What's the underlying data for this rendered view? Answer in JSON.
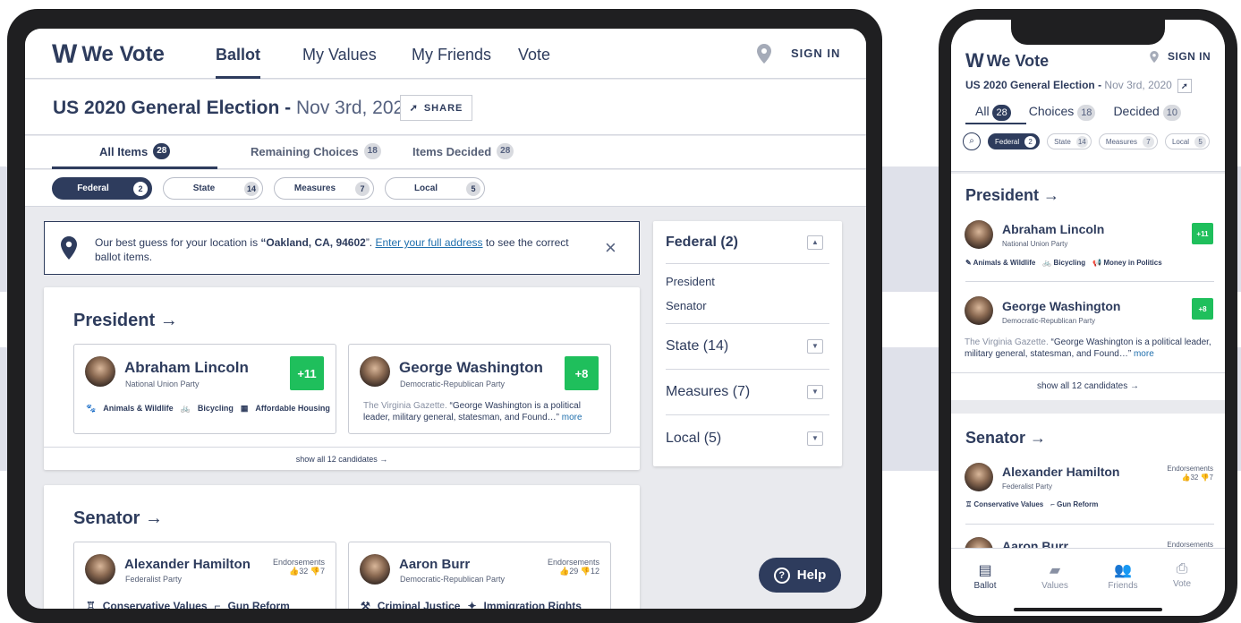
{
  "brand": {
    "name": "We Vote",
    "mark": "W"
  },
  "nav": {
    "ballot": "Ballot",
    "values": "My Values",
    "friends": "My Friends",
    "vote": "Vote",
    "signin": "SIGN IN"
  },
  "election": {
    "title": "US 2020 General Election",
    "dash": " - ",
    "date": "Nov 3rd, 2020",
    "share": "SHARE"
  },
  "tabs": [
    {
      "label": "All Items",
      "count": "28"
    },
    {
      "label": "Remaining Choices",
      "count": "18"
    },
    {
      "label": "Items Decided",
      "count": "28"
    }
  ],
  "filters": [
    {
      "label": "Federal",
      "count": "2"
    },
    {
      "label": "State",
      "count": "14"
    },
    {
      "label": "Measures",
      "count": "7"
    },
    {
      "label": "Local",
      "count": "5"
    }
  ],
  "location": {
    "prefix": "Our best guess for your location is ",
    "place": "“Oakland, CA, 94602",
    "mid": "”. ",
    "link": "Enter your full address",
    "suffix": " to see the correct ballot items.",
    "close": "×"
  },
  "president": {
    "title": "President →",
    "lincoln": {
      "name": "Abraham Lincoln",
      "party": "National Union Party",
      "score": "+11",
      "tags": [
        "Animals & Wildlife",
        "Bicycling",
        "Affordable Housing"
      ]
    },
    "washington": {
      "name": "George Washington",
      "party": "Democratic-Republican Party",
      "score": "+8",
      "source": "The Virginia Gazette.",
      "quote": " “George Washington is a political leader, military general, statesman, and Found…”",
      "more": " more"
    },
    "showall": "show all 12 candidates →"
  },
  "senator": {
    "title": "Senator →",
    "hamilton": {
      "name": "Alexander Hamilton",
      "party": "Federalist Party",
      "endorse_label": "Endorsements",
      "up": "32",
      "down": "7",
      "tags": [
        "Conservative Values",
        "Gun Reform"
      ]
    },
    "burr": {
      "name": "Aaron Burr",
      "party": "Democratic-Republican Party",
      "endorse_label": "Endorsements",
      "up": "29",
      "down": "12",
      "tags": [
        "Criminal Justice",
        "Immigration Rights"
      ]
    }
  },
  "sidebar": {
    "federal": "Federal (2)",
    "items": [
      "President",
      "Senator"
    ],
    "state": "State (14)",
    "measures": "Measures (7)",
    "local": "Local (5)"
  },
  "help": "Help",
  "phone": {
    "election_title": "US 2020 General Election - ",
    "tabs": [
      {
        "label": "All",
        "count": "28"
      },
      {
        "label": "Choices",
        "count": "18"
      },
      {
        "label": "Decided",
        "count": "10"
      }
    ],
    "chips": [
      {
        "label": "Federal",
        "count": "2"
      },
      {
        "label": "State",
        "count": "14"
      },
      {
        "label": "Measures",
        "count": "7"
      },
      {
        "label": "Local",
        "count": "5"
      }
    ],
    "lincoln_tags": [
      "Animals & Wildlife",
      "Bicycling",
      "Money in Politics"
    ],
    "hamilton_tags": [
      "Conservative Values",
      "Gun Reform"
    ],
    "burr_name": "Aaron Burr",
    "bottom_nav": [
      "Ballot",
      "Values",
      "Friends",
      "Vote"
    ]
  },
  "colors": {
    "navy": "#2e3c5d",
    "green": "#1fbf5c",
    "link": "#1f6fad"
  }
}
